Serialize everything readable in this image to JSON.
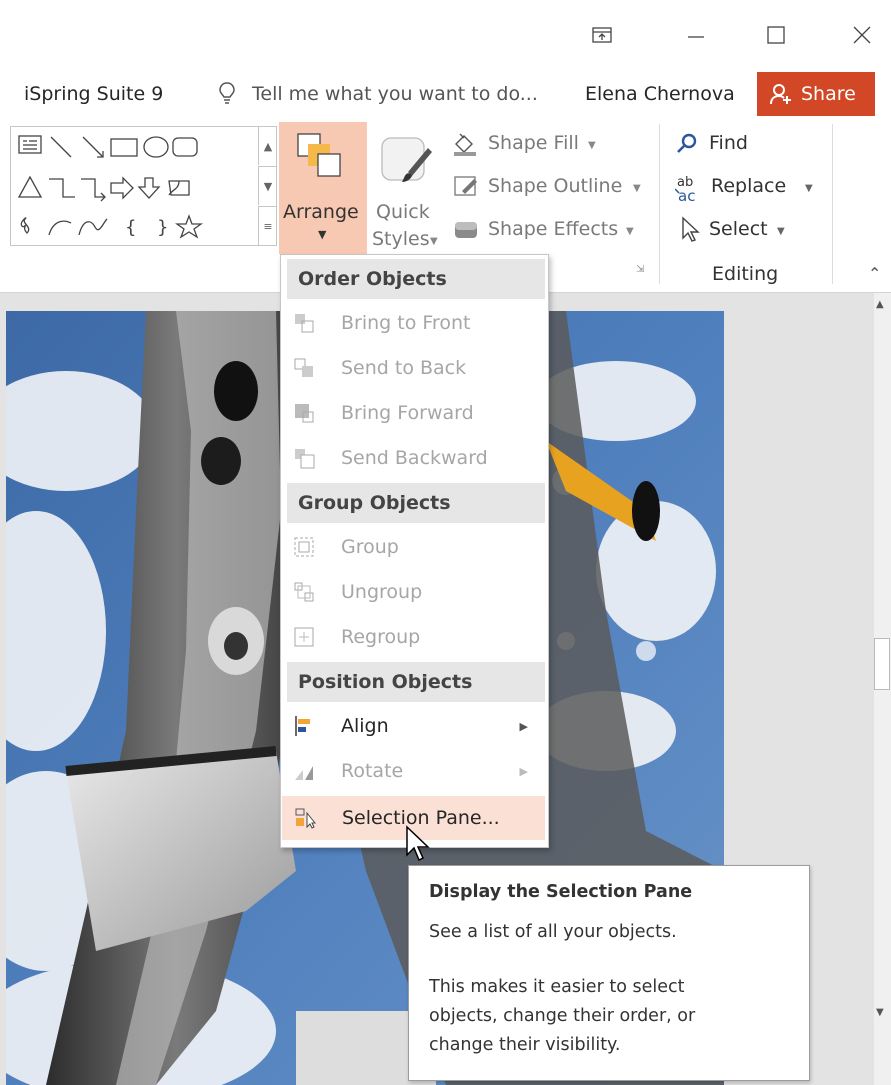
{
  "window": {
    "ribbon_display_icon": "ribbon-display-options-icon",
    "minimize_icon": "minimize-icon",
    "maximize_icon": "maximize-icon",
    "close_icon": "close-icon"
  },
  "tell_row": {
    "app_tab": "iSpring Suite 9",
    "tell_me": "Tell me what you want to do...",
    "user": "Elena Chernova",
    "share": "Share"
  },
  "ribbon": {
    "arrange": "Arrange",
    "quick_styles_1": "Quick",
    "quick_styles_2": "Styles",
    "shape_fill": "Shape Fill",
    "shape_outline": "Shape Outline",
    "shape_effects": "Shape Effects",
    "find": "Find",
    "replace": "Replace",
    "select": "Select",
    "editing_group": "Editing"
  },
  "menu": {
    "order_header": "Order Objects",
    "bring_to_front": "Bring to Front",
    "send_to_back": "Send to Back",
    "bring_forward": "Bring Forward",
    "send_backward": "Send Backward",
    "group_header": "Group Objects",
    "group": "Group",
    "ungroup": "Ungroup",
    "regroup": "Regroup",
    "position_header": "Position Objects",
    "align": "Align",
    "rotate": "Rotate",
    "selection_pane": "Selection Pane..."
  },
  "tooltip": {
    "title": "Display the Selection Pane",
    "line1": "See a list of all your objects.",
    "line2": "This makes it easier to select",
    "line3": "objects, change their order, or",
    "line4": "change their visibility."
  },
  "colors": {
    "share_bg": "#d24726",
    "arrange_active": "#f8c9b2",
    "menu_highlight": "#fbe0d5"
  }
}
